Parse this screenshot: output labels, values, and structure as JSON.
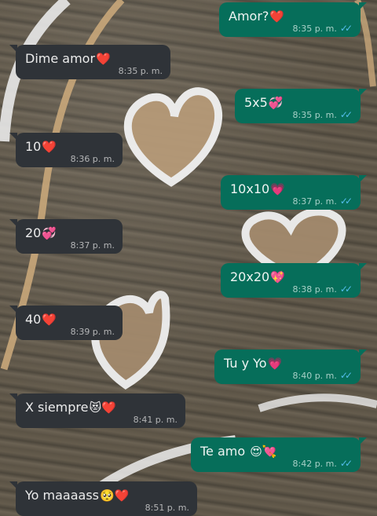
{
  "messages": [
    {
      "side": "out",
      "text": "Amor?",
      "emoji": "❤️",
      "time": "8:35 p. m."
    },
    {
      "side": "in",
      "text": "Dime amor",
      "emoji": "❤️",
      "time": "8:35 p. m."
    },
    {
      "side": "out",
      "text": "5x5",
      "emoji": "💞",
      "time": "8:35 p. m."
    },
    {
      "side": "in",
      "text": "10",
      "emoji": "❤️",
      "time": "8:36 p. m."
    },
    {
      "side": "out",
      "text": "10x10",
      "emoji": "💗",
      "time": "8:37 p. m."
    },
    {
      "side": "in",
      "text": "20",
      "emoji": "💞",
      "time": "8:37 p. m."
    },
    {
      "side": "out",
      "text": "20x20",
      "emoji": "💖",
      "time": "8:38 p. m."
    },
    {
      "side": "in",
      "text": "40",
      "emoji": "❤️",
      "time": "8:39 p. m."
    },
    {
      "side": "out",
      "text": "Tu y Yo",
      "emoji": "💗",
      "time": "8:40 p. m."
    },
    {
      "side": "in",
      "text": "X siempre",
      "emoji": "😻❤️",
      "time": "8:41 p. m."
    },
    {
      "side": "out",
      "text": "Te amo ",
      "emoji": "😍💘",
      "time": "8:42 p. m."
    },
    {
      "side": "in",
      "text": "Yo maaaass",
      "emoji": "🥺❤️",
      "time": "8:51 p. m."
    }
  ],
  "read_receipt_icon": "double-check-icon",
  "colors": {
    "incoming": "#2f3338",
    "outgoing": "#066e5a",
    "read_tick": "#53bdeb"
  }
}
